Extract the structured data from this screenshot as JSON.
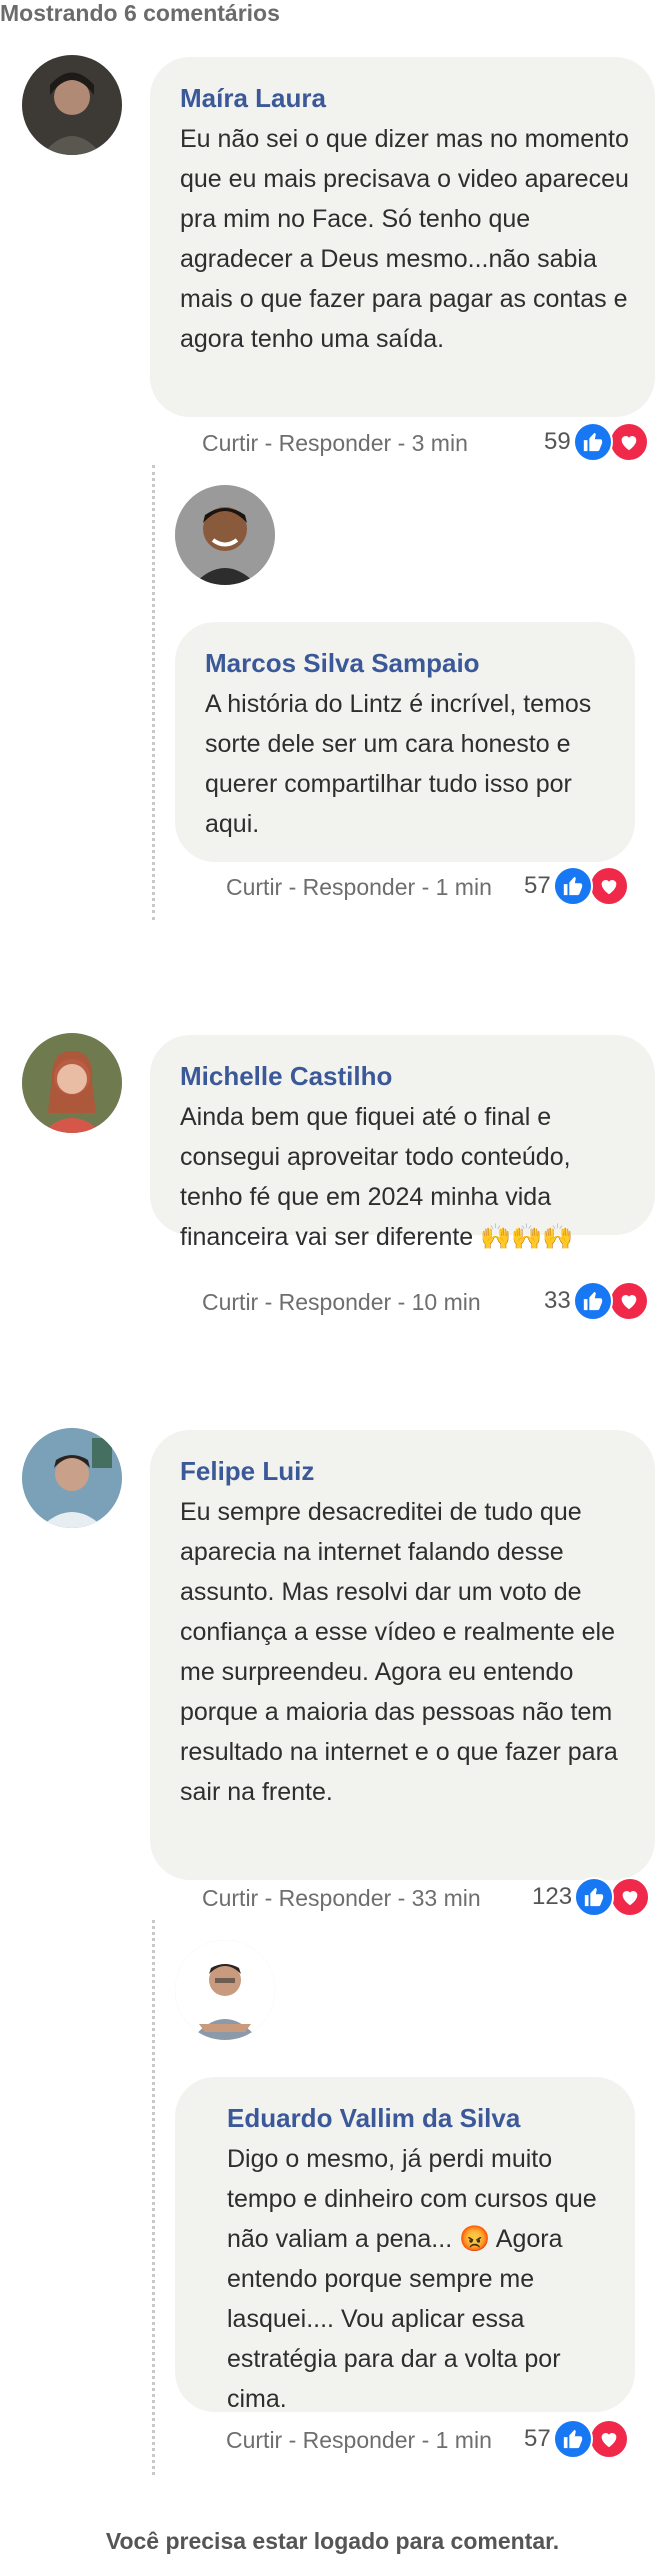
{
  "header": {
    "title": "Mostrando 6 comentários"
  },
  "comments": [
    {
      "author": "Maíra Laura",
      "text": "Eu não sei o que dizer mas no momento que eu mais precisava o video apareceu pra mim no Face. Só tenho que agradecer a Deus mesmo...não sabia mais o que fazer para pagar as contas e agora tenho uma saída.",
      "meta": "Curtir - Responder - 3 min",
      "likes": "59"
    },
    {
      "author": "Marcos Silva Sampaio",
      "text": "A história do Lintz é incrível, temos sorte dele ser um cara honesto e querer compartilhar tudo isso por aqui.",
      "meta": "Curtir - Responder - 1 min",
      "likes": "57"
    },
    {
      "author": "Michelle Castilho",
      "text": "Ainda bem que fiquei até o final e consegui aproveitar todo conteúdo, tenho fé que em 2024 minha vida financeira vai ser diferente 🙌🙌🙌",
      "meta": "Curtir - Responder - 10 min",
      "likes": "33"
    },
    {
      "author": "Felipe Luiz",
      "text": "Eu sempre desacreditei de tudo que aparecia na internet falando desse assunto. Mas resolvi dar um voto de confiança a esse vídeo e realmente ele me surpreendeu. Agora eu entendo porque a maioria das pessoas não tem resultado na internet e o que fazer para sair na frente.",
      "meta": "Curtir - Responder - 33 min",
      "likes": "123"
    },
    {
      "author": "Eduardo Vallim da Silva",
      "text": "Digo o mesmo, já perdi muito tempo e dinheiro com cursos que não valiam a pena... 😡 Agora entendo porque sempre me lasquei.... Vou aplicar essa estratégia para dar a volta por cima.",
      "meta": "Curtir - Responder - 1 min",
      "likes": "57"
    }
  ],
  "footer": {
    "text": "Você precisa estar logado para comentar."
  },
  "colors": {
    "author": "#3b5998",
    "like": "#1877f2",
    "love": "#f02849",
    "bubble": "#f2f2ef"
  },
  "icons": {
    "like": "thumbs-up-icon",
    "love": "heart-icon"
  }
}
